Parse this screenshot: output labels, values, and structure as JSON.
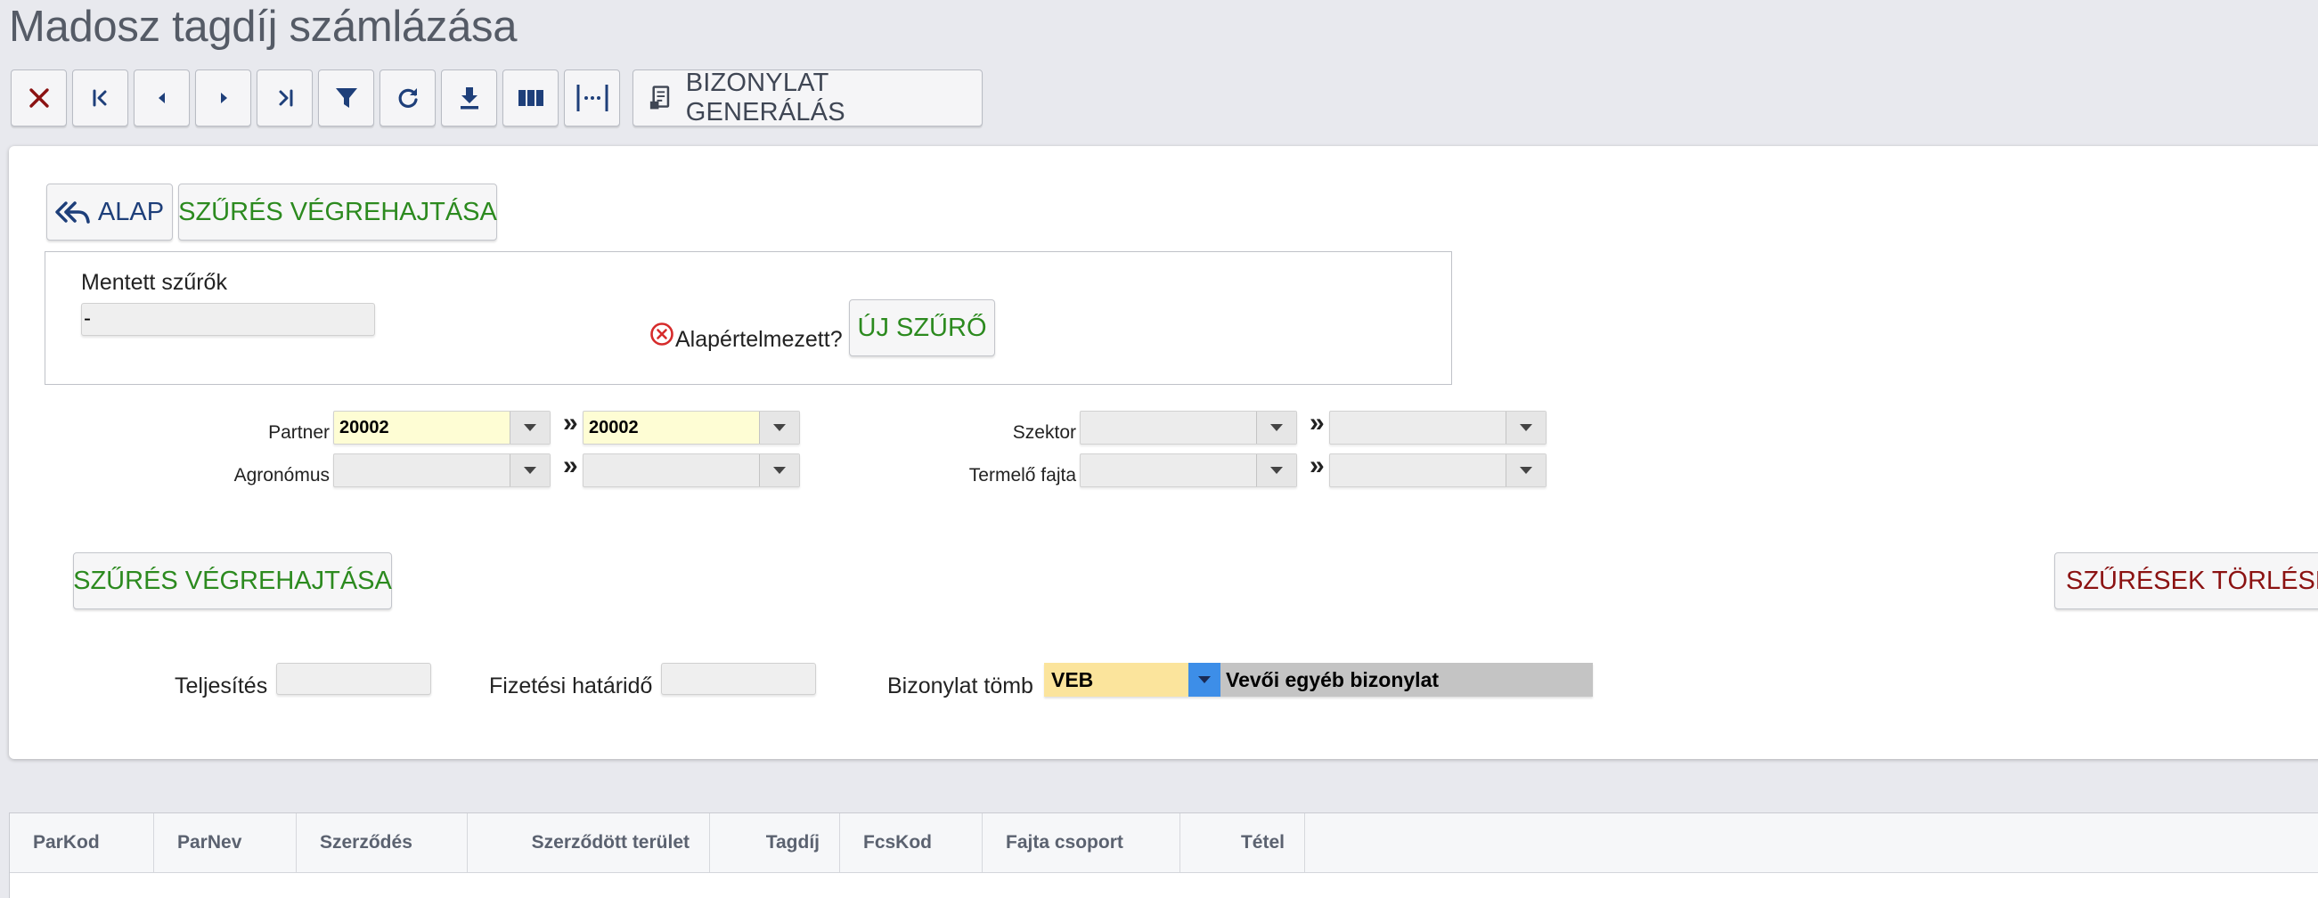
{
  "page": {
    "title": "Madosz tagdíj számlázása"
  },
  "toolbar": {
    "generate_label": "BIZONYLAT GENERÁLÁS",
    "icons": [
      "close-icon",
      "first-record-icon",
      "prev-record-icon",
      "next-record-icon",
      "last-record-icon",
      "filter-icon",
      "refresh-icon",
      "download-icon",
      "columns-icon",
      "column-width-icon",
      "document-generate-icon"
    ]
  },
  "filter": {
    "back_label": "ALAP",
    "execute_label_top": "SZŰRÉS VÉGREHAJTÁSA",
    "saved_filters_label": "Mentett szűrők",
    "saved_filters_value": "-",
    "default_label": "Alapértelmezett?",
    "new_filter_label": "ÚJ SZŰRŐ",
    "partner_label": "Partner",
    "partner_from": "20002",
    "partner_to": "20002",
    "agronomus_label": "Agronómus",
    "agronomus_from": "",
    "agronomus_to": "",
    "szektor_label": "Szektor",
    "szektor_from": "",
    "szektor_to": "",
    "termelo_label": "Termelő fajta",
    "termelo_from": "",
    "termelo_to": "",
    "range_sep": "»",
    "execute_label_bottom": "SZŰRÉS VÉGREHAJTÁSA",
    "clear_label": "SZŰRÉSEK TÖRLÉSE"
  },
  "fields": {
    "teljesites_label": "Teljesítés",
    "teljesites_value": "",
    "fizetesi_label": "Fizetési határidő",
    "fizetesi_value": "",
    "bizonylat_label": "Bizonylat tömb",
    "bizonylat_code": "VEB",
    "bizonylat_name": "Vevői egyéb bizonylat"
  },
  "grid": {
    "columns": [
      "ParKod",
      "ParNev",
      "Szerződés",
      "Szerződött terület",
      "Tagdíj",
      "FcsKod",
      "Fajta csoport",
      "Tétel"
    ]
  },
  "colors": {
    "accent_green": "#2c8a1f",
    "accent_blue": "#1e3f7a",
    "accent_red": "#8b1212",
    "field_yellow": "#fefdd4",
    "combo_orange": "#fbe49c",
    "dropdown_blue": "#3d8ee8"
  }
}
